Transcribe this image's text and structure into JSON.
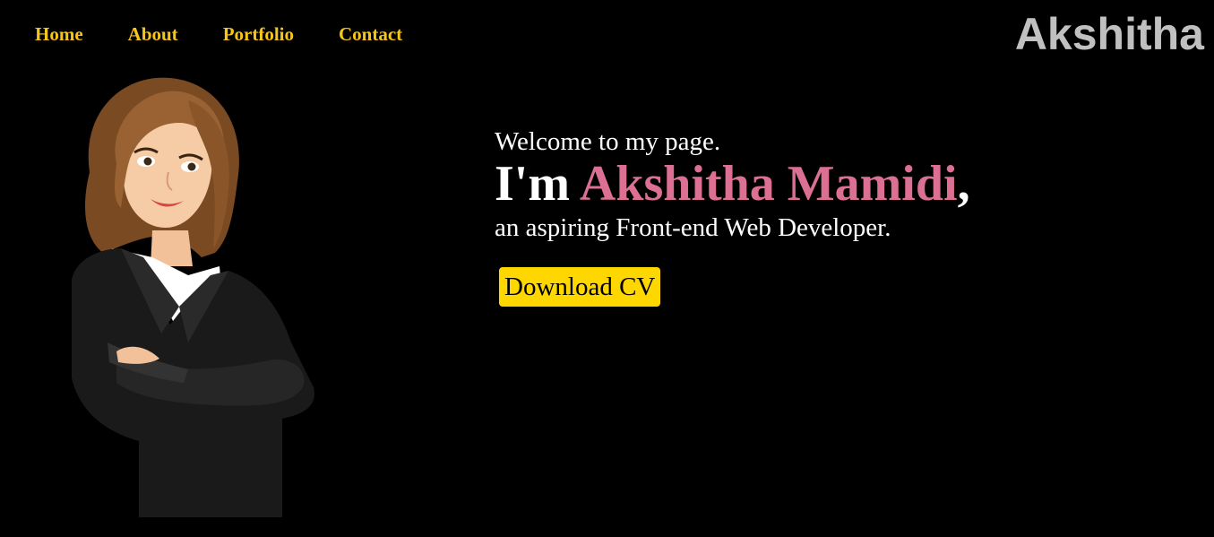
{
  "nav": {
    "items": [
      {
        "label": "Home"
      },
      {
        "label": "About"
      },
      {
        "label": "Portfolio"
      },
      {
        "label": "Contact"
      }
    ]
  },
  "brand": "Akshitha",
  "hero": {
    "welcome": "Welcome to my page.",
    "intro": "I'm ",
    "name": "Akshitha Mamidi",
    "comma": ",",
    "tagline": "an aspiring Front-end Web Developer.",
    "cv_button": "Download CV"
  },
  "colors": {
    "background": "#000000",
    "nav_link": "#f5c518",
    "brand": "#c0c0c0",
    "name_accent": "#db7093",
    "button": "#ffd700"
  },
  "icons": {
    "avatar": "businesswoman-illustration"
  }
}
